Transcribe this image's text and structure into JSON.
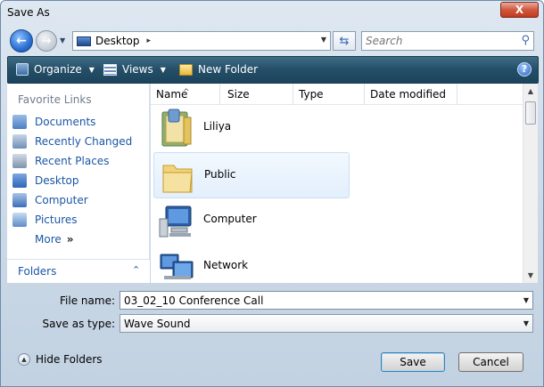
{
  "window": {
    "title": "Save As",
    "close_label": "X"
  },
  "nav": {
    "back_glyph": "←",
    "forward_glyph": "→",
    "address_crumb": "Desktop",
    "crumb_sep": "▸",
    "search_placeholder": "Search"
  },
  "toolbar": {
    "organize_label": "Organize",
    "views_label": "Views",
    "new_folder_label": "New Folder",
    "help_glyph": "?"
  },
  "sidebar": {
    "favorites_title": "Favorite Links",
    "links": [
      {
        "label": "Documents",
        "icon": "documents-icon",
        "color": "#4a7fc4"
      },
      {
        "label": "Recently Changed",
        "icon": "recently-changed-icon",
        "color": "#6e8fb5"
      },
      {
        "label": "Recent Places",
        "icon": "recent-places-icon",
        "color": "#7e93ad"
      },
      {
        "label": "Desktop",
        "icon": "desktop-icon",
        "color": "#2e66b8"
      },
      {
        "label": "Computer",
        "icon": "computer-icon",
        "color": "#3b6eb6"
      },
      {
        "label": "Pictures",
        "icon": "pictures-icon",
        "color": "#5c8cc9"
      },
      {
        "label": "More",
        "icon": "more-chevron-icon",
        "color": "#1a56a5"
      }
    ],
    "more_glyph": "»",
    "folders_label": "Folders",
    "folders_chevron": "⌃"
  },
  "filelist": {
    "columns": [
      "Name",
      "Size",
      "Type",
      "Date modified"
    ],
    "sort_glyph": "^",
    "items": [
      {
        "name": "Liliya",
        "icon": "user-folder-icon",
        "selected": false
      },
      {
        "name": "Public",
        "icon": "folder-icon",
        "selected": true
      },
      {
        "name": "Computer",
        "icon": "computer-icon",
        "selected": false
      },
      {
        "name": "Network",
        "icon": "network-icon",
        "selected": false
      }
    ]
  },
  "form": {
    "filename_label": "File name:",
    "filename_value": "03_02_10 Conference Call",
    "type_label": "Save as type:",
    "type_value": "Wave Sound"
  },
  "footer": {
    "hide_folders_label": "Hide Folders",
    "save_label": "Save",
    "cancel_label": "Cancel"
  },
  "colors": {
    "accent": "#1a56a5",
    "toolbar": "#244e67",
    "selection": "#e3effc"
  }
}
